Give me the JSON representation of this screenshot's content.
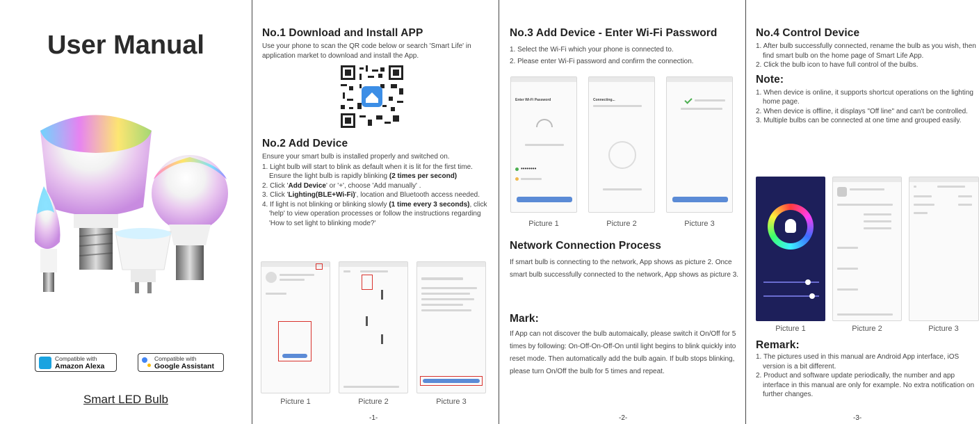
{
  "panel1": {
    "title": "User Manual",
    "badge_alexa": {
      "line1": "Compatible with",
      "line2": "Amazon Alexa"
    },
    "badge_google": {
      "line1": "Compatible with",
      "line2": "Google Assistant"
    },
    "product_name": "Smart LED Bulb"
  },
  "panel2": {
    "s1_title": "No.1 Download and Install APP",
    "s1_text": "Use your phone to scan the QR code below or search 'Smart Life' in application market to download and install the App.",
    "s2_title": "No.2 Add Device",
    "s2_intro": "Ensure your smart bulb is installed properly and switched on.",
    "steps": [
      {
        "a": "1. Light bulb will start to blink as default when it is lit for the first time. Ensure the light bulb is rapidly blinking ",
        "b": "(2 times per second)",
        "c": ""
      },
      {
        "a": "2. Click '",
        "b": "Add Device",
        "c": "' or '+', choose 'Add manually' ."
      },
      {
        "a": "3. Click '",
        "b": "Lighting(BLE+Wi-Fi)",
        "c": "', location and Bluetooth access needed."
      },
      {
        "a": "4. If light is not blinking or blinking slowly ",
        "b": "(1 time every 3 seconds)",
        "c": ", click 'help' to view operation processes or follow the instructions regarding 'How to set light to blinking mode?'"
      }
    ],
    "captions": [
      "Picture 1",
      "Picture 2",
      "Picture 3"
    ],
    "page": "-1-"
  },
  "panel3": {
    "title": "No.3 Add Device - Enter Wi-Fi Password",
    "steps": [
      "1. Select the Wi-Fi which your phone is connected to.",
      "2. Please enter Wi-Fi password and confirm the connection."
    ],
    "phone1_title": "Enter Wi-Fi Password",
    "phone1_password": "••••••••",
    "phone2_title": "Connecting...",
    "captions": [
      "Picture 1",
      "Picture 2",
      "Picture 3"
    ],
    "ncp_title": "Network Connection Process",
    "ncp_text": "If smart bulb is connecting to the network, App shows as picture 2. Once smart bulb successfully connected to the network, App shows as picture 3.",
    "mark_title": "Mark:",
    "mark_text": "If App can not discover the bulb automaically, please switch it On/Off for 5 times by following: On-Off-On-Off-On until light begins to blink quickly into reset mode. Then automatically add the bulb again. If bulb stops blinking, please turn On/Off the bulb for 5 times and repeat.",
    "page": "-2-"
  },
  "panel4": {
    "title": "No.4 Control Device",
    "steps": [
      "1. After bulb successfully connected, rename the bulb as you wish, then find smart bulb on the home page of Smart Life App.",
      "2. Click the bulb icon to have full control of the bulbs."
    ],
    "note_title": "Note:",
    "notes": [
      "1. When device is online, it supports shortcut operations on the lighting home page.",
      "2. When device is offline, it displays \"Off line\" and can't be controlled.",
      "3. Multiple bulbs can be connected at one time and grouped easily."
    ],
    "captions": [
      "Picture 1",
      "Picture 2",
      "Picture 3"
    ],
    "remark_title": "Remark:",
    "remarks": [
      "1. The pictures used in this manual are Android App interface, iOS version is a bit different.",
      "2. Product and software update periodically, the number and app interface in this manual are only for example. No extra notification on further changes."
    ],
    "page": "-3-"
  },
  "colors": {
    "divider": "#444444",
    "highlight_box": "#d8322d",
    "app_blue": "#5b8bd6",
    "alexa_blue": "#1aa3e0",
    "google_blue": "#4285f4",
    "google_yellow": "#fbbc05"
  }
}
